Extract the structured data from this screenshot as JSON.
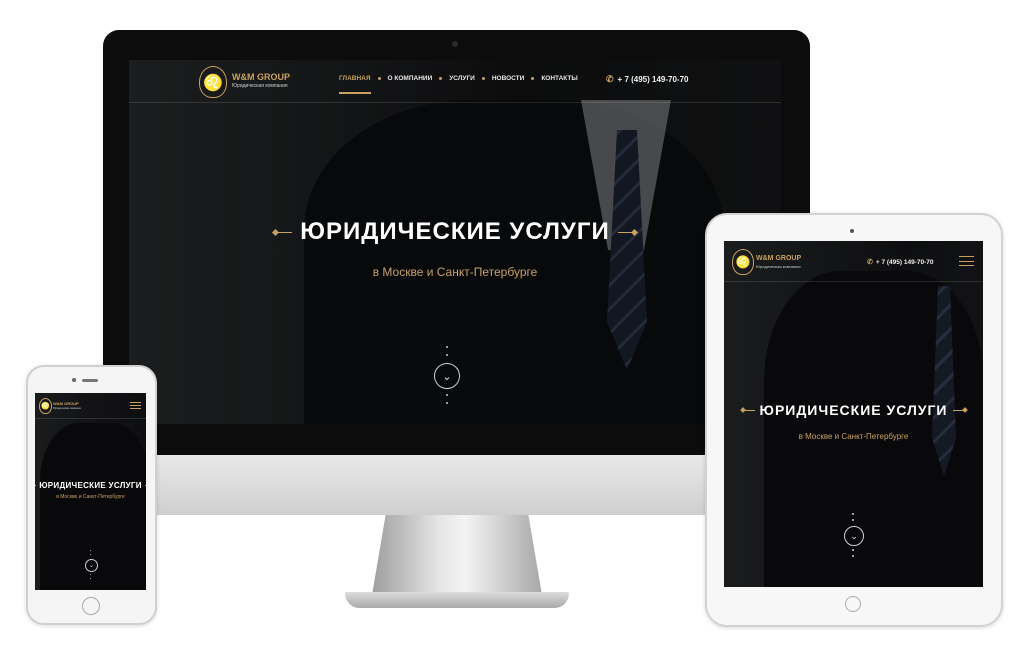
{
  "brand": {
    "name": "W&M GROUP",
    "tagline": "Юридическая компания",
    "logo_icon": "lion-head-icon",
    "accent_color": "#c8a15e"
  },
  "desktop": {
    "nav": [
      {
        "label": "ГЛАВНАЯ",
        "active": true
      },
      {
        "label": "О КОМПАНИИ",
        "active": false
      },
      {
        "label": "УСЛУГИ",
        "active": false
      },
      {
        "label": "НОВОСТИ",
        "active": false
      },
      {
        "label": "КОНТАКТЫ",
        "active": false
      }
    ],
    "phone": "+ 7 (495) 149-70-70",
    "phone_icon": "phone-icon",
    "hero_title": "ЮРИДИЧЕСКИЕ УСЛУГИ",
    "hero_subtitle": "в Москве и Санкт-Петербурге",
    "scroll_icon": "chevron-down-icon"
  },
  "tablet": {
    "phone": "+ 7 (495) 149-70-70",
    "menu_icon": "hamburger-menu-icon",
    "hero_title": "ЮРИДИЧЕСКИЕ УСЛУГИ",
    "hero_subtitle": "в Москве и Санкт-Петербурге"
  },
  "mobile": {
    "menu_icon": "hamburger-menu-icon",
    "hero_title": "ЮРИДИЧЕСКИЕ УСЛУГИ",
    "hero_subtitle": "в Москве и Санкт-Петербурге"
  }
}
